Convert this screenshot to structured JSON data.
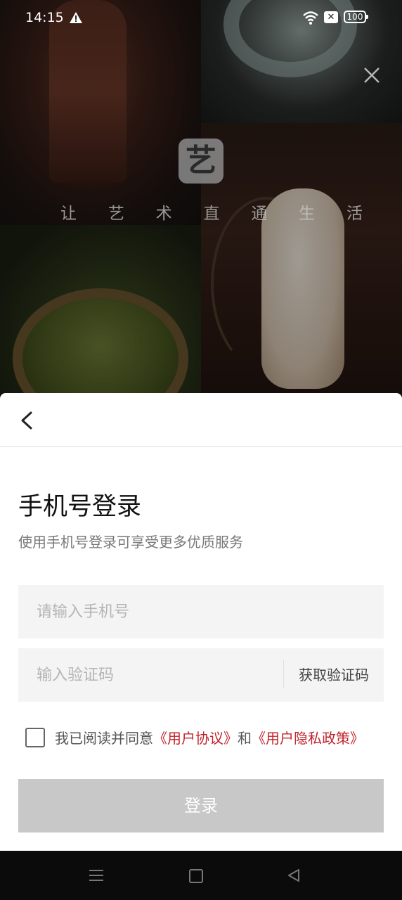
{
  "status_bar": {
    "time": "14:15",
    "battery": "100"
  },
  "splash": {
    "logo_char": "艺",
    "slogan": [
      "让",
      "艺",
      "术",
      "直",
      "通",
      "生",
      "活"
    ]
  },
  "login": {
    "title": "手机号登录",
    "subtitle": "使用手机号登录可享受更多优质服务",
    "phone_placeholder": "请输入手机号",
    "code_placeholder": "输入验证码",
    "get_code": "获取验证码",
    "agree_prefix": "我已阅读并同意",
    "user_agreement": "《用户协议》",
    "and": "和",
    "privacy_policy": "《用户隐私政策》",
    "login_button": "登录"
  },
  "colors": {
    "link": "#c0242c",
    "button_disabled": "#c8c8c8"
  }
}
